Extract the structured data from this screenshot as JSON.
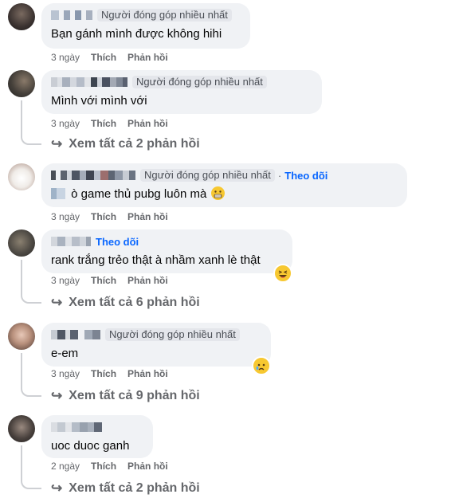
{
  "common": {
    "like": "Thích",
    "reply": "Phản hồi",
    "badge": "Người đóng góp nhiều nhất",
    "follow": "Theo dõi",
    "separator": "·",
    "view_prefix": "↪"
  },
  "comments": [
    {
      "time": "3 ngày",
      "text": "Bạn gánh mình được không hihi",
      "badge": "Người đóng góp nhiều nhất"
    },
    {
      "time": "3 ngày",
      "text": "Mình với mình với",
      "badge": "Người đóng góp nhiều nhất",
      "replies": "Xem tất cả 2 phản hồi"
    },
    {
      "time": "3 ngày",
      "text": "ò game thủ pubg luôn mà",
      "badge": "Người đóng góp nhiều nhất",
      "follow": "Theo dõi",
      "emoji": "grimacing-emoji"
    },
    {
      "time": "3 ngày",
      "text": "rank trắng trẻo thật à nhầm xanh lè thật",
      "follow": "Theo dõi",
      "reaction": "haha-reaction",
      "replies": "Xem tất cả 6 phản hồi"
    },
    {
      "time": "3 ngày",
      "text": "e-em",
      "badge": "Người đóng góp nhiều nhất",
      "reaction": "sad-reaction",
      "replies": "Xem tất cả 9 phản hồi"
    },
    {
      "time": "2 ngày",
      "text": "uoc duoc ganh",
      "replies": "Xem tất cả 2 phản hồi"
    }
  ],
  "colors": {
    "bubble": "#f0f2f5",
    "link": "#0866ff",
    "muted": "#65676b",
    "thread": "#ced0d4"
  }
}
